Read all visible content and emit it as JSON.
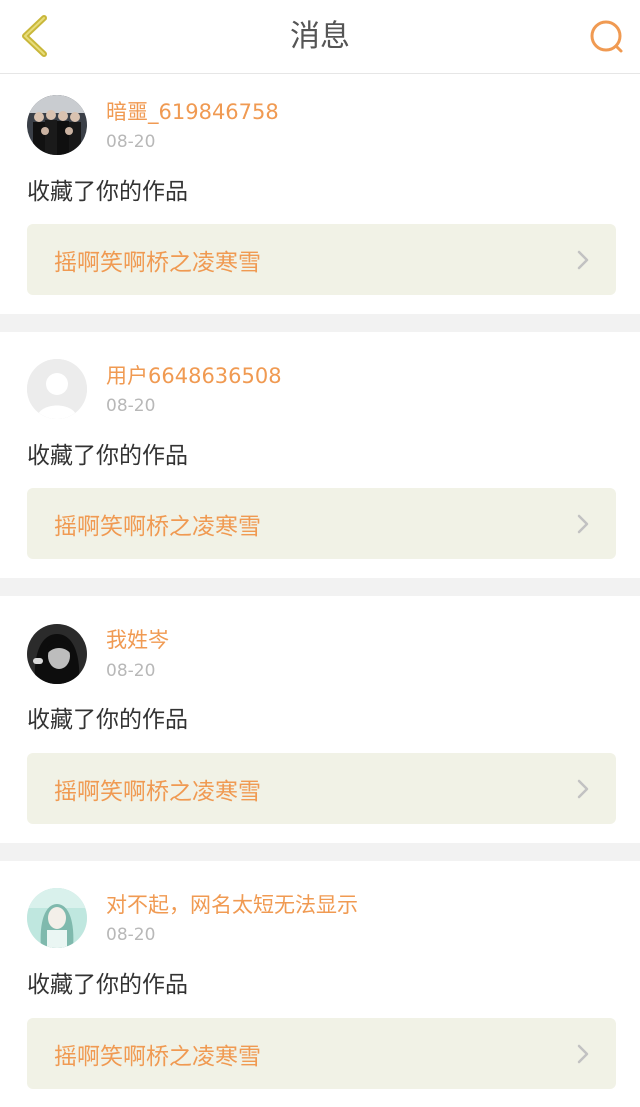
{
  "header": {
    "title": "消息"
  },
  "colors": {
    "accent": "#f09a52",
    "back_icon": "#c9b73a",
    "work_bg": "#f1f2e6",
    "chevron": "#c2c2c2"
  },
  "messages": [
    {
      "username": "暗噩_619846758",
      "date": "08-20",
      "action": "收藏了你的作品",
      "work_title": "摇啊笑啊桥之凌寒雪",
      "avatar_icon": "group-photo"
    },
    {
      "username": "用户6648636508",
      "date": "08-20",
      "action": "收藏了你的作品",
      "work_title": "摇啊笑啊桥之凌寒雪",
      "avatar_icon": "default-user"
    },
    {
      "username": "我姓岑",
      "date": "08-20",
      "action": "收藏了你的作品",
      "work_title": "摇啊笑啊桥之凌寒雪",
      "avatar_icon": "dark-portrait"
    },
    {
      "username": "对不起，网名太短无法显示",
      "date": "08-20",
      "action": "收藏了你的作品",
      "work_title": "摇啊笑啊桥之凌寒雪",
      "avatar_icon": "teal-portrait"
    }
  ]
}
